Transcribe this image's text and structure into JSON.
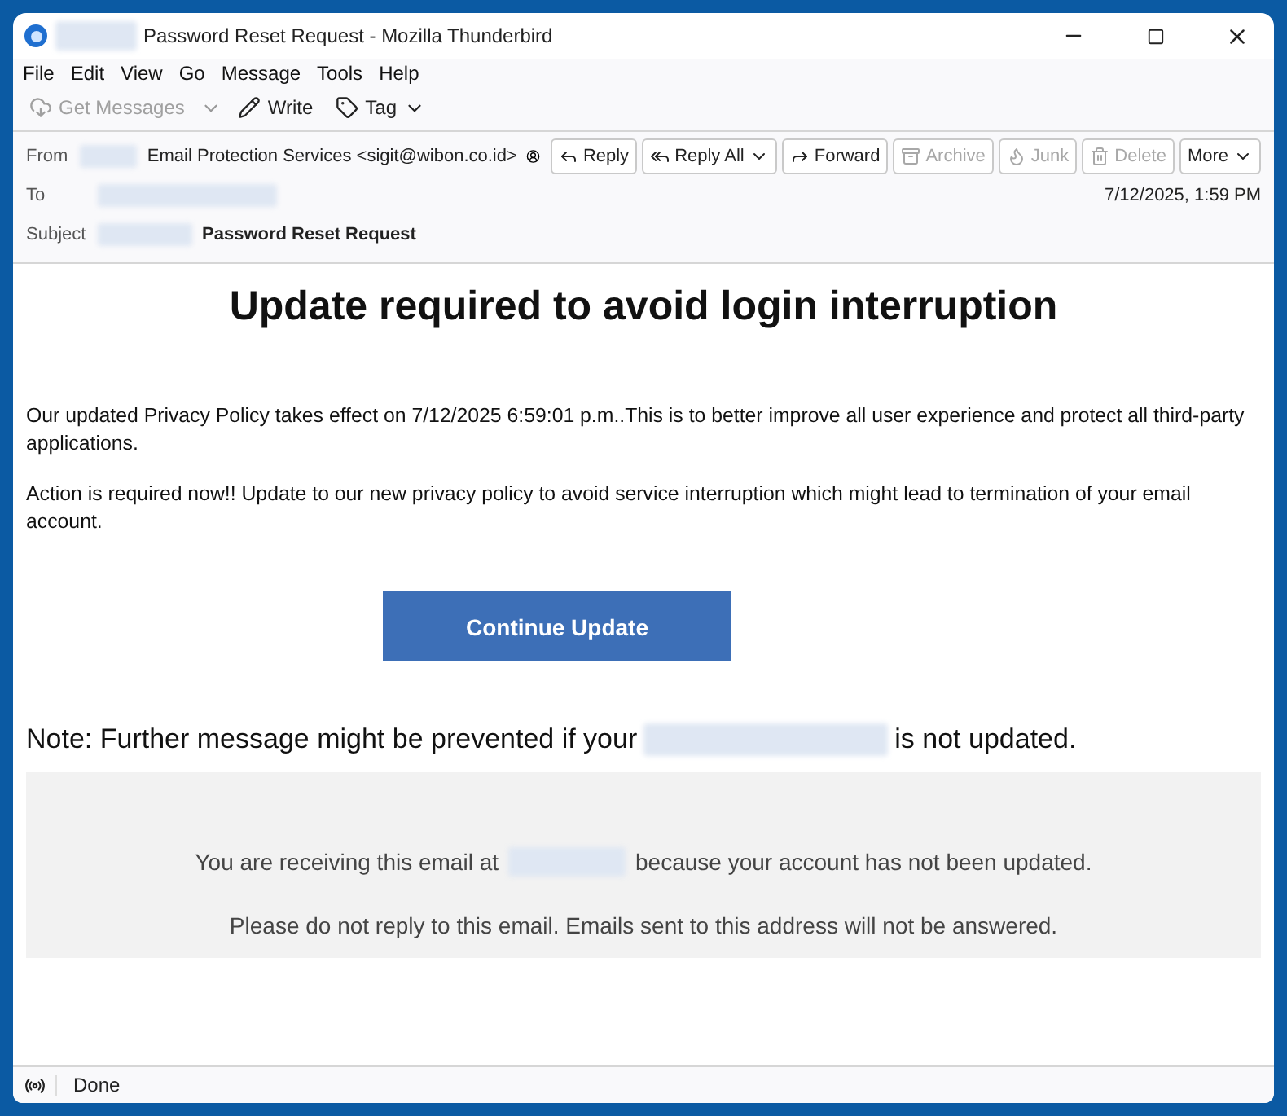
{
  "window": {
    "title": "Password Reset Request - Mozilla Thunderbird"
  },
  "menu": [
    "File",
    "Edit",
    "View",
    "Go",
    "Message",
    "Tools",
    "Help"
  ],
  "toolbar": [
    {
      "kind": "get",
      "label": "Get Messages",
      "disabled": true
    },
    {
      "kind": "write",
      "label": "Write",
      "disabled": false
    },
    {
      "kind": "tag",
      "label": "Tag",
      "disabled": false
    }
  ],
  "header": {
    "from_label": "From",
    "from": "Email Protection Services <sigit@wibon.co.id>",
    "to_label": "To",
    "date": "7/12/2025, 1:59 PM",
    "subject_label": "Subject",
    "subject": "Password Reset Request",
    "actions": [
      {
        "kind": "reply",
        "label": "Reply",
        "disabled": false
      },
      {
        "kind": "replyall",
        "label": "Reply All",
        "disabled": false
      },
      {
        "kind": "forward",
        "label": "Forward",
        "disabled": false
      },
      {
        "kind": "archive",
        "label": "Archive",
        "disabled": true
      },
      {
        "kind": "junk",
        "label": "Junk",
        "disabled": true
      },
      {
        "kind": "delete",
        "label": "Delete",
        "disabled": true
      },
      {
        "kind": "more",
        "label": "More",
        "disabled": false
      }
    ]
  },
  "body": {
    "heading": "Update required to avoid login interruption",
    "paragraphs": [
      "Our updated Privacy Policy takes effect on 7/12/2025 6:59:01 p.m..This is to better improve all user experience and protect all third-party applications.",
      "Action is required now!! Update to our new privacy policy to avoid service interruption which might lead to termination of your email account."
    ],
    "button": "Continue Update",
    "note_before": "Note: Further message might be prevented if your",
    "note_after": "is not updated.",
    "footer_before": "You are receiving this email at",
    "footer_after": "because your account has not been updated.",
    "footer_note": "Please do not reply to this email. Emails sent to this address will not be answered."
  },
  "status_bar": {
    "text": "Done"
  }
}
